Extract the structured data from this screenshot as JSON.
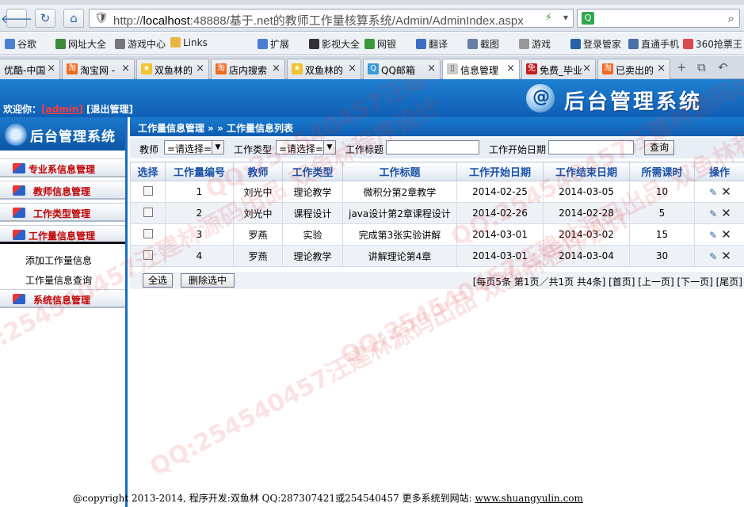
{
  "browser": {
    "url_host": "localhost",
    "url_rest": ":48888/基于.net的教师工作量核算系统/Admin/AdminIndex.aspx",
    "url_prefix": "http://",
    "bookmarks": [
      "谷歌",
      "网址大全",
      "游戏中心",
      "Links",
      "扩展",
      "影视大全",
      "网银",
      "翻译",
      "截图",
      "游戏",
      "登录管家",
      "直通手机",
      "360抢票王"
    ],
    "tabs": [
      "优酷-中国",
      "淘宝网 -",
      "双鱼林的",
      "店内搜索",
      "双鱼林的",
      "QQ邮箱",
      "信息管理",
      "免费_毕业",
      "已卖出的"
    ]
  },
  "header": {
    "welcome_prefix": "欢迎你：",
    "username": "[admin]",
    "logout": "[退出管理]",
    "system_title": "后台管理系统"
  },
  "sidebar": {
    "title": "后台管理系统",
    "menus": [
      {
        "label": "专业系信息管理"
      },
      {
        "label": "教师信息管理"
      },
      {
        "label": "工作类型管理"
      },
      {
        "label": "工作量信息管理"
      },
      {
        "label": "系统信息管理"
      }
    ],
    "sub_items": [
      "添加工作量信息",
      "工作量信息查询"
    ]
  },
  "content": {
    "breadcrumb": "工作量信息管理 » » 工作量信息列表",
    "filters": {
      "teacher_label": "教师",
      "teacher_value": "=请选择=",
      "type_label": "工作类型",
      "type_value": "=请选择=",
      "title_label": "工作标题",
      "title_value": "",
      "start_label": "工作开始日期",
      "start_value": "",
      "query_button": "查询"
    },
    "columns": [
      "选择",
      "工作量编号",
      "教师",
      "工作类型",
      "工作标题",
      "工作开始日期",
      "工作结束日期",
      "所需课时",
      "操作"
    ],
    "rows": [
      {
        "id": "1",
        "teacher": "刘光中",
        "type": "理论教学",
        "title": "微积分第2章教学",
        "start": "2014-02-25",
        "end": "2014-03-05",
        "hours": "10"
      },
      {
        "id": "2",
        "teacher": "刘光中",
        "type": "课程设计",
        "title": "java设计第2章课程设计",
        "start": "2014-02-26",
        "end": "2014-02-28",
        "hours": "5"
      },
      {
        "id": "3",
        "teacher": "罗燕",
        "type": "实验",
        "title": "完成第3张实验讲解",
        "start": "2014-03-01",
        "end": "2014-03-02",
        "hours": "15"
      },
      {
        "id": "4",
        "teacher": "罗燕",
        "type": "理论教学",
        "title": "讲解理论第4章",
        "start": "2014-03-01",
        "end": "2014-03-04",
        "hours": "30"
      }
    ],
    "select_all": "全选",
    "delete_selected": "删除选中",
    "pager": "[每页5条 第1页／共1页 共4条] [首页] [上一页] [下一页] [尾页]"
  },
  "footer": {
    "text": "@copyright 2013-2014, 程序开发:双鱼林  QQ:287307421或254540457  更多系统到网站: ",
    "site": "www.shuangyulin.com"
  },
  "watermark": "QQ:254540457汪建林源码出品 双鱼林程序设计",
  "colors": {
    "banner_blue": "#0f5fb5",
    "menu_red": "#c00000",
    "header_blue": "#1a52a8"
  }
}
